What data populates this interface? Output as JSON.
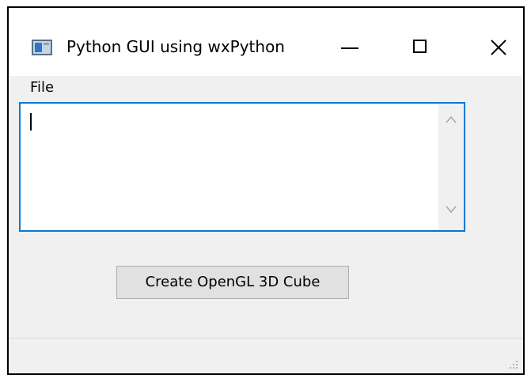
{
  "window": {
    "title": "Python GUI using wxPython",
    "icon": "app-window-icon",
    "controls": {
      "minimize": "minimize-icon",
      "maximize": "maximize-icon",
      "close": "close-icon"
    }
  },
  "menubar": {
    "items": [
      {
        "label": "File"
      }
    ]
  },
  "editor": {
    "value": "",
    "scroll_up_icon": "chevron-up-icon",
    "scroll_down_icon": "chevron-down-icon"
  },
  "actions": {
    "create_cube_label": "Create OpenGL 3D Cube"
  },
  "statusbar": {
    "text": "",
    "grip_icon": "resize-grip-icon"
  },
  "colors": {
    "focus_border": "#0078d7",
    "window_bg": "#f0f0f0",
    "button_bg": "#e1e1e1"
  }
}
